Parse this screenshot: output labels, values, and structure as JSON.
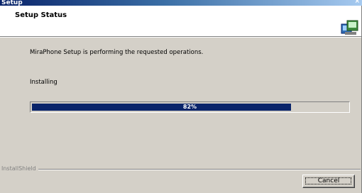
{
  "window": {
    "title": "Setup"
  },
  "header": {
    "heading": "Setup Status"
  },
  "body": {
    "status_message": "MiraPhone Setup is performing the requested operations.",
    "phase": "Installing"
  },
  "progress": {
    "value": 82,
    "label": "82%",
    "fill_color": "#0a246a"
  },
  "footer": {
    "group_label": "InstallShield",
    "cancel_label": "Cancel"
  }
}
